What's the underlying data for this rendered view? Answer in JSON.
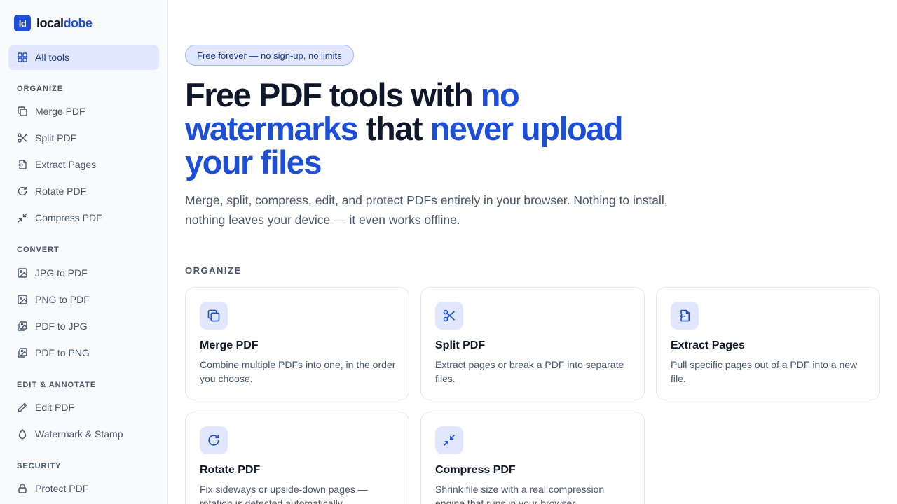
{
  "brand": {
    "mark": "ld",
    "name_a": "local",
    "name_b": "dobe"
  },
  "sidebar": {
    "all_tools": "All tools",
    "sections": [
      {
        "label": "ORGANIZE",
        "items": [
          "Merge PDF",
          "Split PDF",
          "Extract Pages",
          "Rotate PDF",
          "Compress PDF"
        ]
      },
      {
        "label": "CONVERT",
        "items": [
          "JPG to PDF",
          "PNG to PDF",
          "PDF to JPG",
          "PDF to PNG"
        ]
      },
      {
        "label": "EDIT & ANNOTATE",
        "items": [
          "Edit PDF",
          "Watermark & Stamp"
        ]
      },
      {
        "label": "SECURITY",
        "items": [
          "Protect PDF"
        ]
      }
    ]
  },
  "hero": {
    "pill": "Free forever — no sign-up, no limits",
    "title_1": "Free PDF tools with ",
    "title_2": "no watermarks",
    "title_3": " that ",
    "title_4": "never upload your files",
    "subtitle": "Merge, split, compress, edit, and protect PDFs entirely in your browser. Nothing to install, nothing leaves your device — it even works offline."
  },
  "grid": {
    "label": "ORGANIZE",
    "cards": [
      {
        "title": "Merge PDF",
        "desc": "Combine multiple PDFs into one, in the order you choose.",
        "icon": "copy-icon"
      },
      {
        "title": "Split PDF",
        "desc": "Extract pages or break a PDF into separate files.",
        "icon": "scissors-icon"
      },
      {
        "title": "Extract Pages",
        "desc": "Pull specific pages out of a PDF into a new file.",
        "icon": "file-export-icon"
      },
      {
        "title": "Rotate PDF",
        "desc": "Fix sideways or upside-down pages — rotation is detected automatically.",
        "icon": "rotate-icon"
      },
      {
        "title": "Compress PDF",
        "desc": "Shrink file size with a real compression engine that runs in your browser.",
        "icon": "compress-icon"
      }
    ]
  },
  "colors": {
    "accent": "#1d4ed8",
    "accent_soft": "#e0e7ff",
    "text": "#0f172a",
    "muted": "#475569"
  }
}
